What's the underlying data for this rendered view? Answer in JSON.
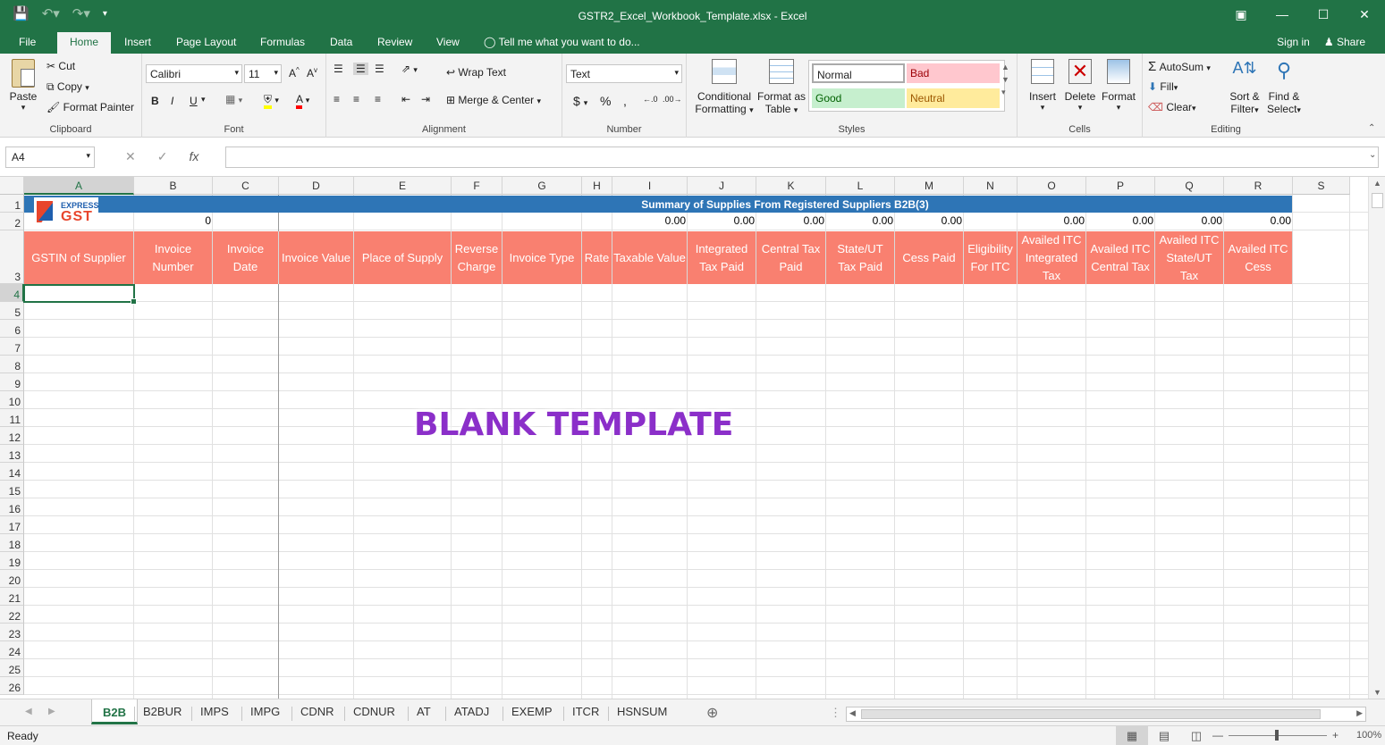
{
  "window": {
    "title": "GSTR2_Excel_Workbook_Template.xlsx - Excel"
  },
  "ribbon_tabs": [
    "File",
    "Home",
    "Insert",
    "Page Layout",
    "Formulas",
    "Data",
    "Review",
    "View"
  ],
  "active_tab": "Home",
  "tell_me": "Tell me what you want to do...",
  "account": {
    "signin": "Sign in",
    "share": "Share"
  },
  "clipboard": {
    "paste": "Paste",
    "cut": "Cut",
    "copy": "Copy",
    "format_painter": "Format Painter",
    "label": "Clipboard"
  },
  "font": {
    "name": "Calibri",
    "size": "11",
    "label": "Font",
    "bold": "B",
    "italic": "I",
    "underline": "U"
  },
  "alignment": {
    "wrap": "Wrap Text",
    "merge": "Merge & Center",
    "label": "Alignment"
  },
  "number": {
    "format": "Text",
    "currency": "$",
    "percent": "%",
    "comma": ",",
    "label": "Number"
  },
  "styles": {
    "conditional": "Conditional",
    "conditional2": "Formatting",
    "format_table": "Format as",
    "format_table2": "Table",
    "normal": "Normal",
    "bad": "Bad",
    "good": "Good",
    "neutral": "Neutral",
    "label": "Styles",
    "colors": {
      "normal": "#ffffff",
      "bad": "#ffc7ce",
      "good": "#c6efce",
      "neutral": "#ffeb9c"
    }
  },
  "cells": {
    "insert": "Insert",
    "delete": "Delete",
    "format": "Format",
    "label": "Cells"
  },
  "editing": {
    "autosum": "AutoSum",
    "fill": "Fill",
    "clear": "Clear",
    "sort": "Sort &",
    "sort2": "Filter",
    "find": "Find &",
    "find2": "Select",
    "label": "Editing"
  },
  "formula_bar": {
    "name_box": "A4",
    "fx": "fx",
    "content": ""
  },
  "columns": [
    "A",
    "B",
    "C",
    "D",
    "E",
    "F",
    "G",
    "H",
    "I",
    "J",
    "K",
    "L",
    "M",
    "N",
    "O",
    "P",
    "Q",
    "R",
    "S"
  ],
  "rows": [
    "1",
    "2",
    "3",
    "4",
    "5",
    "6",
    "7",
    "8",
    "9",
    "10",
    "11",
    "12",
    "13",
    "14",
    "15",
    "16",
    "17",
    "18",
    "19",
    "20",
    "21",
    "22",
    "23",
    "24",
    "25",
    "26"
  ],
  "logo": {
    "top": "EXPRESS",
    "bottom": "GST"
  },
  "banner": "Summary of Supplies From Registered Suppliers B2B(3)",
  "row2_values": {
    "B": "0",
    "I": "0.00",
    "J": "0.00",
    "K": "0.00",
    "L": "0.00",
    "M": "0.00",
    "O": "0.00",
    "P": "0.00",
    "Q": "0.00",
    "R": "0.00"
  },
  "headers": [
    "GSTIN of Supplier",
    "Invoice Number",
    "Invoice Date",
    "Invoice Value",
    "Place of Supply",
    "Reverse Charge",
    "Invoice Type",
    "Rate",
    "Taxable Value",
    "Integrated Tax Paid",
    "Central Tax Paid",
    "State/UT Tax Paid",
    "Cess Paid",
    "Eligibility For ITC",
    "Availed ITC Integrated Tax",
    "Availed ITC Central Tax",
    "Availed ITC State/UT Tax",
    "Availed ITC Cess"
  ],
  "header_color": "#f98070",
  "banner_color": "#2e75b6",
  "accent": "#217346",
  "watermark": "BLANK TEMPLATE",
  "sheets": [
    "B2B",
    "B2BUR",
    "IMPS",
    "IMPG",
    "CDNR",
    "CDNUR",
    "AT",
    "ATADJ",
    "EXEMP",
    "ITCR",
    "HSNSUM"
  ],
  "active_sheet": "B2B",
  "status": {
    "ready": "Ready",
    "zoom": "100%"
  }
}
